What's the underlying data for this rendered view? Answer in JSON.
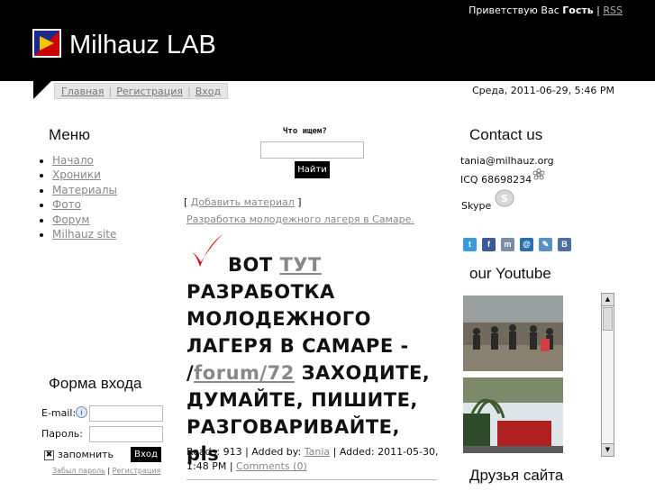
{
  "header": {
    "greeting_prefix": "Приветствую Вас",
    "user": "Гость",
    "separator": "|",
    "rss": "RSS",
    "site_name": "Milhauz LAB"
  },
  "nav": {
    "items": [
      "Главная",
      "Регистрация",
      "Вход"
    ],
    "datetime": "Среда, 2011-06-29, 5:46 PM"
  },
  "menu": {
    "title": "Меню",
    "items": [
      "Начало",
      "Хроники",
      "Материалы",
      "Фото",
      "Форум",
      "Milhauz site"
    ]
  },
  "search": {
    "label": "Что ищем?",
    "button": "Найти"
  },
  "content": {
    "add_open": "[",
    "add_link": "Добавить материал",
    "add_close": "]",
    "article_title": "Разработка молодежного лагеря в Самаре.",
    "big_prefix": "ВОТ",
    "big_link1": "ТУТ",
    "big_mid": "РАЗРАБОТКА МОЛОДЕЖНОГО ЛАГЕРЯ В САМАРЕ - /",
    "big_link2": "forum/72",
    "big_suffix": "ЗАХОДИТЕ, ДУМАЙТЕ, ПИШИТЕ, РАЗГОВАРИВАЙТЕ, pls",
    "meta_reads": "Reads: 913 | Added by:",
    "meta_author": "Tania",
    "meta_added": "| Added: 2011-05-30, 1:48 PM |",
    "meta_comments": "Comments (0)"
  },
  "login": {
    "title": "Форма входа",
    "email_label": "E-mail:",
    "password_label": "Пароль:",
    "remember": "запомнить",
    "button": "Вход",
    "forgot": "Забыл пароль",
    "sep": "|",
    "register": "Регистрация"
  },
  "contact": {
    "title": "Contact us",
    "email": "tania@milhauz.org",
    "icq": "ICQ 68698234",
    "skype": "Skype"
  },
  "social": {
    "icons": [
      {
        "name": "twitter-icon",
        "glyph": "t",
        "color": "#3a9bd9"
      },
      {
        "name": "facebook-icon",
        "glyph": "f",
        "color": "#3b5998"
      },
      {
        "name": "myspace-icon",
        "glyph": "m",
        "color": "#7a8fa6"
      },
      {
        "name": "mail-icon",
        "glyph": "@",
        "color": "#2a6fb0"
      },
      {
        "name": "livejournal-icon",
        "glyph": "✎",
        "color": "#5b8fc7"
      },
      {
        "name": "vkontakte-icon",
        "glyph": "В",
        "color": "#4a6fa0"
      }
    ]
  },
  "youtube": {
    "title": "our Youtube"
  },
  "friends": {
    "title": "Друзья сайта"
  },
  "colors": {
    "header_bg": "#000000",
    "link": "#888888"
  }
}
